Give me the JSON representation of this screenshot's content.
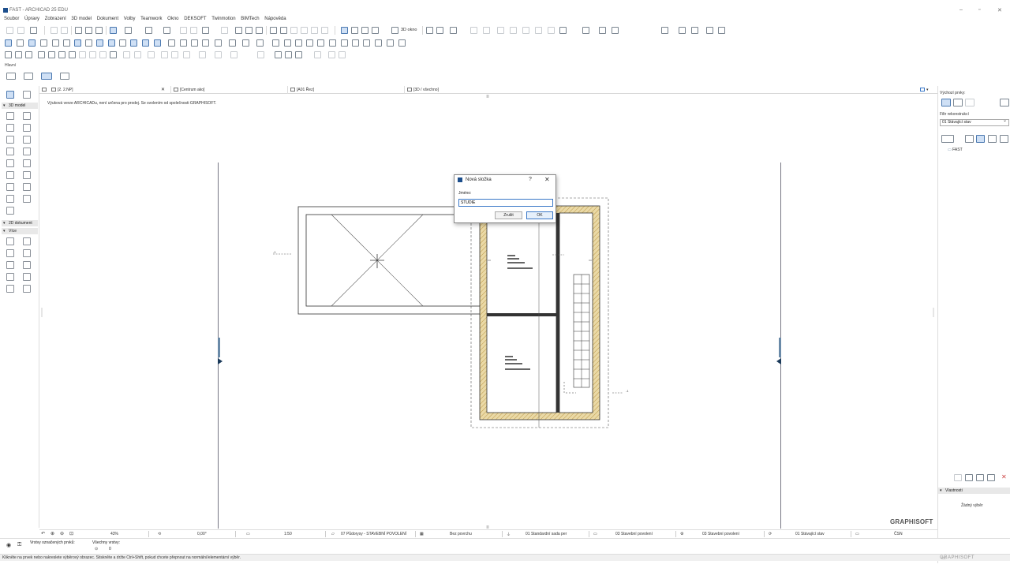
{
  "window": {
    "title": "FAST - ARCHICAD 25 EDU"
  },
  "menu": [
    "Soubor",
    "Úpravy",
    "Zobrazení",
    "3D model",
    "Dokument",
    "Volby",
    "Teamwork",
    "Okno",
    "DEKSOFT",
    "Twinmotion",
    "BIMTech",
    "Nápověda"
  ],
  "toolbar": {
    "view3d_label": "3D okno",
    "group_label": "Hlavní"
  },
  "tabs": [
    {
      "label": "[2. 2.NP]"
    },
    {
      "label": "[Centrum ako]"
    },
    {
      "label": "[A01 Řez]"
    },
    {
      "label": "[3D / všechno]"
    }
  ],
  "toolbox": {
    "section1": "3D model",
    "section2": "2D dokument",
    "section3": "Více"
  },
  "canvas": {
    "notice": "Výuková verze ARCHICADu, není určena pro prodej. Se svolením od společnosti GRAPHISOFT."
  },
  "dialog": {
    "title": "Nová složka",
    "help": "?",
    "close": "✕",
    "field_label": "Jméno:",
    "field_value": "STUDIE",
    "cancel_label": "Zrušit",
    "ok_label": "OK"
  },
  "right_panel": {
    "default_elements_label": "Výchozí prvky:",
    "filter_label": "Filtr rekonstrukcí",
    "filter_value": "01 Stávající stav",
    "tree_item": "FAST",
    "properties_label": "Vlastnosti",
    "no_selection": "Žádný výběr"
  },
  "status": {
    "zoom": "43%",
    "angle": "0,00°",
    "scale": "1:50",
    "layer_combo": "07 Půdorysy - STAVEBNÍ POVOLENÍ",
    "surface": "Bez povrchu",
    "pen_set": "01 Standardní sada per",
    "model_view": "03 Stavební povolení",
    "dimension": "03 Stavební povolení",
    "renovation": "01 Stávající stav",
    "standard": "ČSN"
  },
  "bottom": {
    "layers_selected_label": "Vrstvy označených prvků:",
    "all_layers_label": "Všechny vrstvy:",
    "all_layers_count": "0"
  },
  "hint": "Klikněte na prvek nebo nakreslete výběrový obrazec. Stiskněte a držte Ctrl+Shift, pokud chcete přepnout na normální/elementární výběr.",
  "brand": "GRAPHISOFT",
  "colors": {
    "accent": "#3a78c8",
    "wall_fill": "#e8d9a8",
    "wall_hatch": "#b8860b"
  }
}
